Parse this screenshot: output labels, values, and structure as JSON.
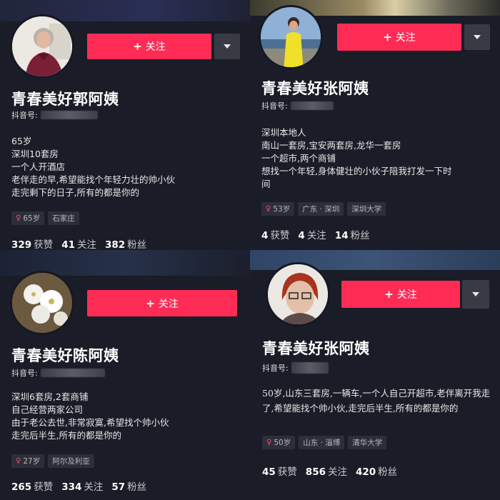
{
  "follow_label": "关注",
  "douyin_id_label": "抖音号:",
  "profiles": [
    {
      "name": "青春美好郭阿姨",
      "bio": [
        "65岁",
        "深圳10套房",
        "一个人开酒店",
        "老伴走的早,希望能找个年轻力壮的帅小伙",
        "走完剩下的日子,所有的都是你的"
      ],
      "tags": [
        {
          "text": "65岁",
          "gender": "female"
        },
        {
          "text": "石家庄"
        }
      ],
      "stats": {
        "likes": "329",
        "likes_label": "获赞",
        "following": "41",
        "following_label": "关注",
        "followers": "382",
        "followers_label": "粉丝"
      }
    },
    {
      "name": "青春美好张阿姨",
      "bio": [
        "深圳本地人",
        "南山一套房,宝安两套房,龙华一套房",
        "一个超市,两个商铺",
        "想找一个年轻,身体健壮的小伙子陪我打发一下时",
        "间"
      ],
      "tags": [
        {
          "text": "53岁",
          "gender": "female"
        },
        {
          "text": "广东 · 深圳"
        },
        {
          "text": "深圳大学"
        }
      ],
      "stats": {
        "likes": "4",
        "likes_label": "获赞",
        "following": "4",
        "following_label": "关注",
        "followers": "14",
        "followers_label": "粉丝"
      }
    },
    {
      "name": "青春美好陈阿姨",
      "bio": [
        "深圳6套房,2套商铺",
        "自己经营两家公司",
        "由于老公去世,非常寂寞,希望找个帅小伙",
        "走完后半生,所有的都是你的"
      ],
      "tags": [
        {
          "text": "27岁",
          "gender": "female"
        },
        {
          "text": "阿尔及利亚"
        }
      ],
      "stats": {
        "likes": "265",
        "likes_label": "获赞",
        "following": "334",
        "following_label": "关注",
        "followers": "57",
        "followers_label": "粉丝"
      }
    },
    {
      "name": "青春美好张阿姨",
      "bio": [
        "50岁,山东三套房,一辆车,一个人自己开超市,老伴离开我走了,希望能找个帅小伙,走完后半生,所有的都是你的"
      ],
      "tags": [
        {
          "text": "50岁",
          "gender": "female"
        },
        {
          "text": "山东 · 淄博"
        },
        {
          "text": "清华大学"
        }
      ],
      "stats": {
        "likes": "45",
        "likes_label": "获赞",
        "following": "856",
        "following_label": "关注",
        "followers": "420",
        "followers_label": "粉丝"
      }
    }
  ],
  "colors": {
    "background": "#161823",
    "follow_button": "#fe2c55",
    "tag_bg": "#2c2e39"
  },
  "icons": {
    "plus": "plus-icon",
    "dropdown": "chevron-down-icon",
    "gender": "female-icon"
  }
}
